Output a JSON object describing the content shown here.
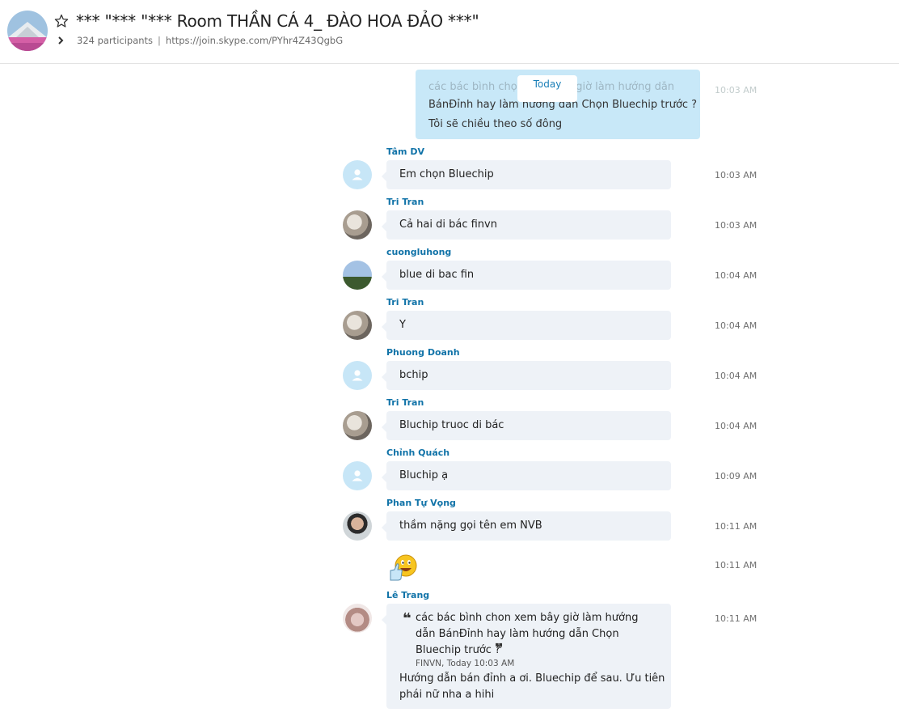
{
  "header": {
    "title": "*** \"*** \"*** Room THẦN CÁ 4_ ĐÀO HOA ĐẢO ***\"",
    "participants": "324 participants",
    "separator": "|",
    "join_link": "https://join.skype.com/PYhr4Z43QgbG"
  },
  "top_quote": {
    "ghost_line": "các bác bình chọn xem bây giờ làm hướng dẫn",
    "line2": "BánĐỉnh hay làm hướng dẫn Chọn Bluechip trước ?",
    "line3": "Tôi sẽ chiều theo số đông",
    "ghost_time": "10:03 AM"
  },
  "day_label": "Today",
  "messages": [
    {
      "sender": "Tâm DV",
      "text": "Em chọn Bluechip",
      "time": "10:03 AM"
    },
    {
      "sender": "Tri Tran",
      "text": "Cả hai di bác finvn",
      "time": "10:03 AM"
    },
    {
      "sender": "cuongluhong",
      "text": "blue di bac fin",
      "time": "10:04 AM"
    },
    {
      "sender": "Tri Tran",
      "text": "Y",
      "time": "10:04 AM"
    },
    {
      "sender": "Phuong Doanh",
      "text": "bchip",
      "time": "10:04 AM"
    },
    {
      "sender": "Tri Tran",
      "text": "Bluchip truoc di bác",
      "time": "10:04 AM"
    },
    {
      "sender": "Chỉnh Quách",
      "text": "Bluchip ạ",
      "time": "10:09 AM"
    },
    {
      "sender": "Phan Tự Vọng",
      "text": "thầm nặng gọi tên em NVB",
      "time": "10:11 AM"
    }
  ],
  "emoji_message": {
    "icon": "thumbs-up-smiley-emoji",
    "time": "10:11 AM"
  },
  "last_message": {
    "sender": "Lê Trang",
    "time": "10:11 AM",
    "quote_line1": "các bác bình chon xem bây giờ làm hướng",
    "quote_line2": "dẫn BánĐỉnh hay làm hướng dẫn Chọn",
    "quote_line3": "Bluechip trước ?",
    "quote_meta": "FINVN, Today 10:03 AM",
    "reply_line1": "Hướng dẫn bán đỉnh a ơi. Bluechip để sau. Ưu tiên",
    "reply_line2": "phái nữ nha a hihi"
  },
  "colors": {
    "sender_name": "#1173a8",
    "bubble_bg": "#eef2f7",
    "own_bubble_bg": "#c8e8f8",
    "default_avatar": "#c7e6f7"
  }
}
